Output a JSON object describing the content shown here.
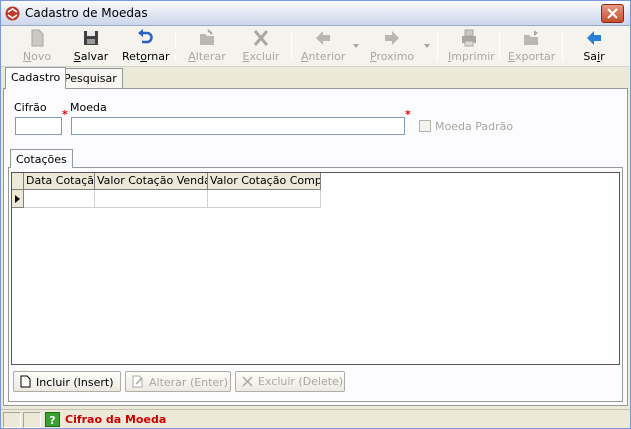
{
  "window": {
    "title": "Cadastro de Moedas"
  },
  "toolbar": {
    "novo": "Novo",
    "salvar": "Salvar",
    "retornar": "Retornar",
    "alterar": "Alterar",
    "excluir": "Excluir",
    "anterior": "Anterior",
    "proximo": "Proximo",
    "imprimir": "Imprimir",
    "exportar": "Exportar",
    "sair": "Sair"
  },
  "tabs": {
    "cadastro": "Cadastro",
    "pesquisar": "Pesquisar"
  },
  "form": {
    "cifrao_label": "Cifrão",
    "cifrao_value": "",
    "moeda_label": "Moeda",
    "moeda_value": "",
    "required_mark": "*",
    "moeda_padrao_label": "Moeda Padrão",
    "moeda_padrao_checked": false
  },
  "cotacoes": {
    "tab_label": "Cotações",
    "columns": [
      "Data Cotação",
      "Valor Cotação Venda",
      "Valor Cotação Compra"
    ],
    "rows": [
      [
        "",
        "",
        ""
      ]
    ],
    "buttons": {
      "incluir": "Incluir (Insert)",
      "alterar": "Alterar (Enter)",
      "excluir": "Excluir (Delete)"
    }
  },
  "statusbar": {
    "help_icon_glyph": "?",
    "message": "Cifrao da Moeda"
  },
  "colors": {
    "required": "#e00000",
    "status_message": "#d00000",
    "disabled_text": "#a8a8a0"
  }
}
